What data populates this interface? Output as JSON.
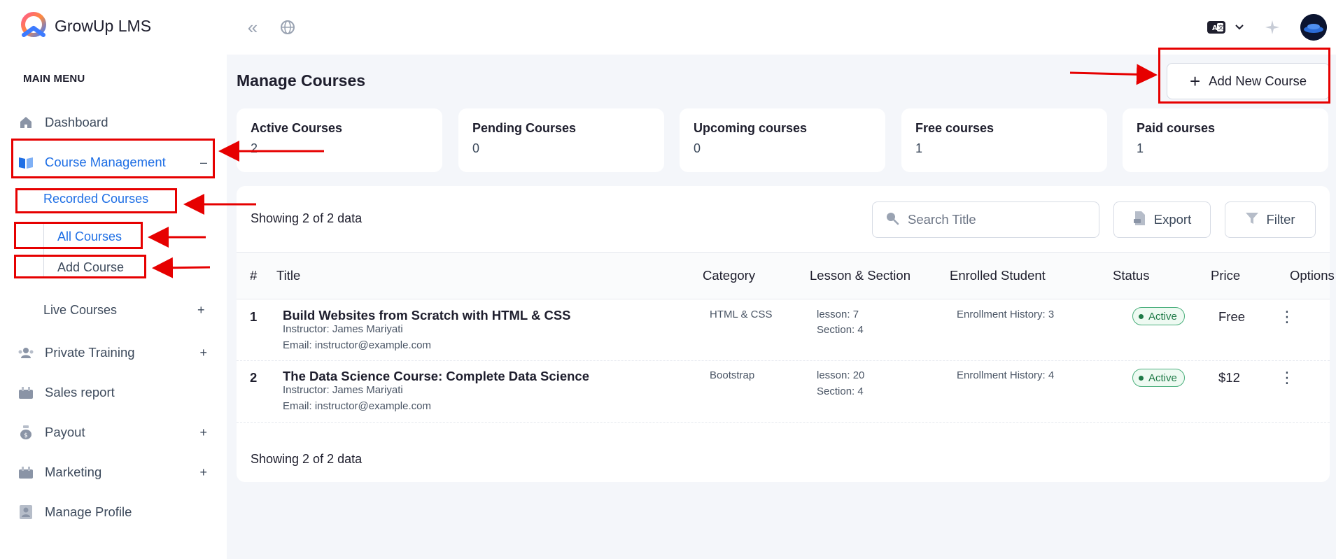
{
  "app": {
    "name": "GrowUp LMS"
  },
  "sidebar": {
    "section_label": "MAIN MENU",
    "items": [
      {
        "label": "Dashboard",
        "icon": "home-icon"
      },
      {
        "label": "Course Management",
        "icon": "book-icon",
        "toggle": "–"
      },
      {
        "label": "Private Training",
        "icon": "users-icon",
        "toggle": "+"
      },
      {
        "label": "Sales report",
        "icon": "chart-icon"
      },
      {
        "label": "Payout",
        "icon": "money-icon",
        "toggle": "+"
      },
      {
        "label": "Marketing",
        "icon": "megaphone-icon",
        "toggle": "+"
      },
      {
        "label": "Manage Profile",
        "icon": "profile-icon"
      }
    ],
    "course_submenu": {
      "recorded": {
        "label": "Recorded Courses",
        "toggle": "–"
      },
      "all_courses": "All Courses",
      "add_course": "Add Course",
      "live": {
        "label": "Live Courses",
        "toggle": "+"
      }
    }
  },
  "page": {
    "title": "Manage Courses",
    "add_button": "Add New Course"
  },
  "stats": [
    {
      "label": "Active Courses",
      "value": "2"
    },
    {
      "label": "Pending Courses",
      "value": "0"
    },
    {
      "label": "Upcoming courses",
      "value": "0"
    },
    {
      "label": "Free courses",
      "value": "1"
    },
    {
      "label": "Paid courses",
      "value": "1"
    }
  ],
  "table": {
    "showing_text": "Showing 2 of 2 data",
    "search_placeholder": "Search Title",
    "export_label": "Export",
    "filter_label": "Filter",
    "headers": [
      "#",
      "Title",
      "Category",
      "Lesson & Section",
      "Enrolled Student",
      "Status",
      "Price",
      "Options"
    ],
    "rows": [
      {
        "num": "1",
        "title": "Build Websites from Scratch with HTML & CSS",
        "instructor": "Instructor: James Mariyati",
        "email": "Email: instructor@example.com",
        "category": "HTML & CSS",
        "lesson": "lesson: 7",
        "section": "Section: 4",
        "enrollment": "Enrollment History: 3",
        "status": "Active",
        "price": "Free",
        "options": "⋮"
      },
      {
        "num": "2",
        "title": "The Data Science Course: Complete Data Science",
        "instructor": "Instructor: James Mariyati",
        "email": "Email: instructor@example.com",
        "category": "Bootstrap",
        "lesson": "lesson: 20",
        "section": "Section: 4",
        "enrollment": "Enrollment History: 4",
        "status": "Active",
        "price": "$12",
        "options": "⋮"
      }
    ]
  },
  "colors": {
    "accent": "#1f6fe5",
    "annotation": "#e60000",
    "active_badge": "#1f7a47"
  }
}
